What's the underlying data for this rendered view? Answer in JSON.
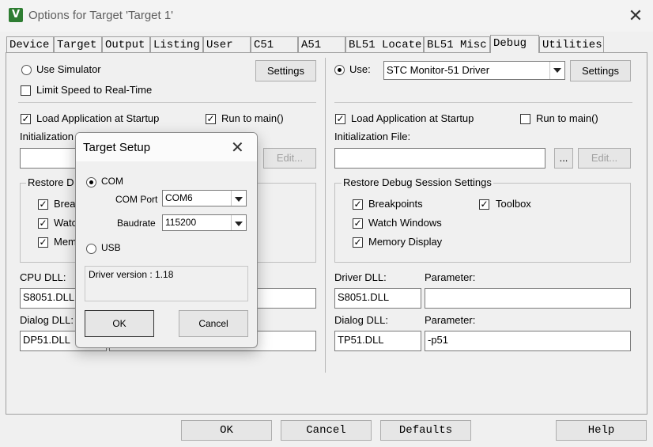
{
  "window": {
    "title": "Options for Target 'Target 1'",
    "icon": "keil-uvision-icon",
    "close_glyph": "✕"
  },
  "tabs": [
    {
      "label": "Device"
    },
    {
      "label": "Target"
    },
    {
      "label": "Output"
    },
    {
      "label": "Listing"
    },
    {
      "label": "User"
    },
    {
      "label": "C51"
    },
    {
      "label": "A51"
    },
    {
      "label": "BL51 Locate"
    },
    {
      "label": "BL51 Misc"
    },
    {
      "label": "Debug",
      "active": true
    },
    {
      "label": "Utilities"
    }
  ],
  "left": {
    "use_simulator": "Use Simulator",
    "settings": "Settings",
    "limit_speed": "Limit Speed to Real-Time",
    "load_app": "Load Application at Startup",
    "run_to_main": "Run to main()",
    "init_file": "Initialization",
    "edit": "Edit...",
    "restore_group": "Restore D",
    "breakpoints": "Brea",
    "watch": "Watc",
    "memory": "Mem",
    "cpu_dll_label": "CPU DLL:",
    "cpu_dll": "S8051.DLL",
    "dialog_dll_label": "Dialog DLL:",
    "dialog_dll": "DP51.DLL"
  },
  "right": {
    "use": "Use:",
    "driver": "STC Monitor-51 Driver",
    "settings": "Settings",
    "load_app": "Load Application at Startup",
    "run_to_main": "Run to main()",
    "init_file_label": "Initialization File:",
    "browse": "...",
    "edit": "Edit...",
    "restore_group": "Restore Debug Session Settings",
    "breakpoints": "Breakpoints",
    "toolbox": "Toolbox",
    "watch": "Watch Windows",
    "memory": "Memory Display",
    "driver_dll_label": "Driver DLL:",
    "driver_dll": "S8051.DLL",
    "parameter_label": "Parameter:",
    "driver_param": "",
    "dialog_dll_label": "Dialog DLL:",
    "dialog_dll": "TP51.DLL",
    "parameter_label2": "Parameter:",
    "dialog_param": "-p51"
  },
  "footer": {
    "ok": "OK",
    "cancel": "Cancel",
    "defaults": "Defaults",
    "help": "Help"
  },
  "dialog": {
    "title": "Target Setup",
    "close_glyph": "✕",
    "com": "COM",
    "com_port_label": "COM Port",
    "com_port": "COM6",
    "baudrate_label": "Baudrate",
    "baudrate": "115200",
    "usb": "USB",
    "driver_version": "Driver version : 1.18",
    "ok": "OK",
    "cancel": "Cancel"
  }
}
